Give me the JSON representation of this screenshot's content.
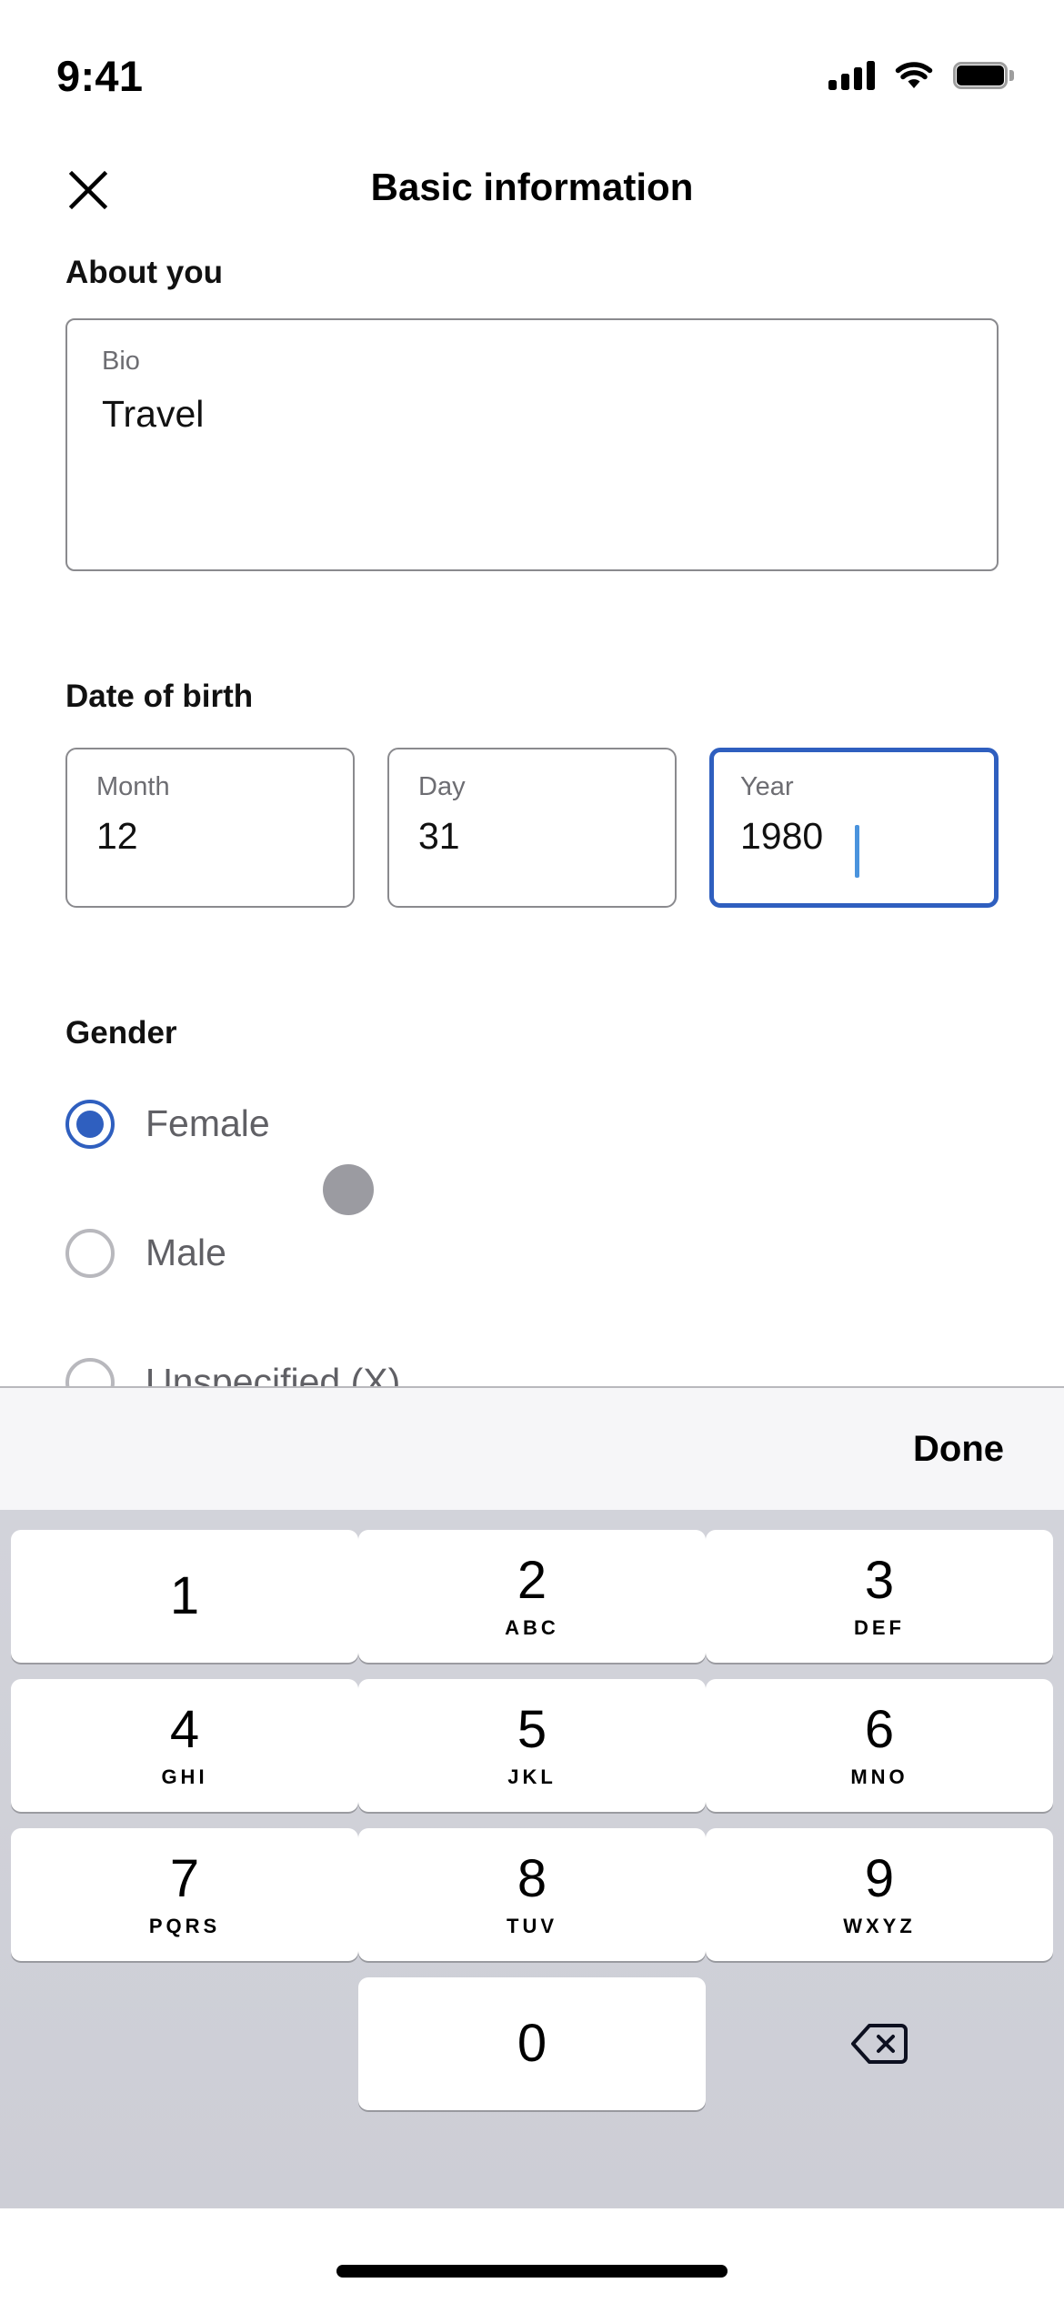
{
  "status_bar": {
    "time": "9:41",
    "signal_icon": "cellular-signal-icon",
    "wifi_icon": "wifi-icon",
    "battery_icon": "battery-full-icon"
  },
  "nav": {
    "close_icon": "close-icon",
    "title": "Basic information"
  },
  "sections": {
    "about": {
      "title": "About you",
      "bio": {
        "label": "Bio",
        "value": "Travel"
      }
    },
    "dob": {
      "title": "Date of birth",
      "fields": [
        {
          "label": "Month",
          "value": "12",
          "focused": false
        },
        {
          "label": "Day",
          "value": "31",
          "focused": false
        },
        {
          "label": "Year",
          "value": "1980",
          "focused": true
        }
      ]
    },
    "gender": {
      "title": "Gender",
      "options": [
        {
          "label": "Female",
          "selected": true
        },
        {
          "label": "Male",
          "selected": false
        },
        {
          "label": "Unspecified (X)",
          "selected": false
        }
      ]
    }
  },
  "keyboard": {
    "done_label": "Done",
    "keys": [
      {
        "num": "1",
        "sub": ""
      },
      {
        "num": "2",
        "sub": "ABC"
      },
      {
        "num": "3",
        "sub": "DEF"
      },
      {
        "num": "4",
        "sub": "GHI"
      },
      {
        "num": "5",
        "sub": "JKL"
      },
      {
        "num": "6",
        "sub": "MNO"
      },
      {
        "num": "7",
        "sub": "PQRS"
      },
      {
        "num": "8",
        "sub": "TUV"
      },
      {
        "num": "9",
        "sub": "WXYZ"
      },
      {
        "num": "0",
        "sub": ""
      }
    ],
    "delete_icon": "backspace-delete-icon"
  },
  "colors": {
    "accent_blue": "#2f5fbf",
    "caret_blue": "#4a93dd",
    "border_gray": "#8a8a8e",
    "label_gray": "#6d6d72",
    "keyboard_bg": "#cdced6",
    "toolbar_bg": "#f6f6f8",
    "touch_indicator": "#9b9ba1"
  },
  "home_indicator": "home-indicator-bar"
}
